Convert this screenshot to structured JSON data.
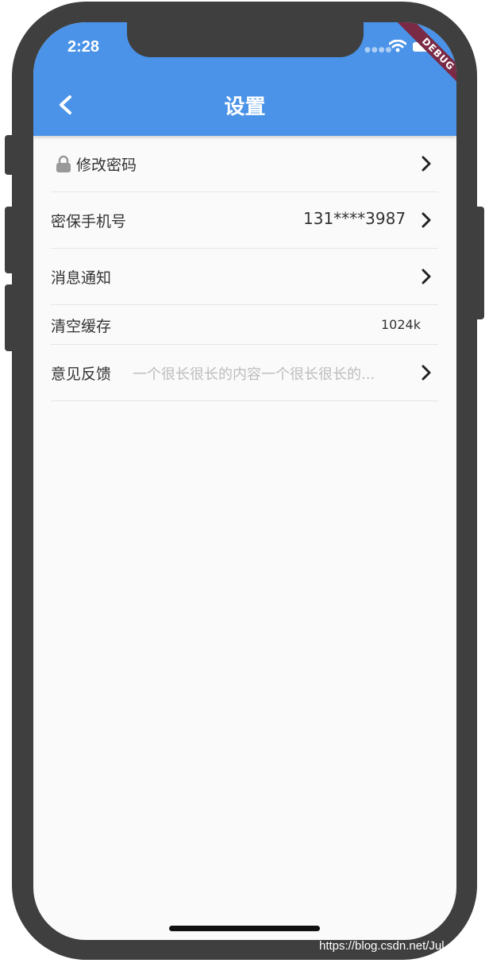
{
  "status_bar": {
    "time": "2:28",
    "debug_label": "DEBUG"
  },
  "app_bar": {
    "title": "设置"
  },
  "settings": {
    "change_password": {
      "label": "修改密码"
    },
    "security_phone": {
      "label": "密保手机号",
      "value": "131****3987"
    },
    "notifications": {
      "label": "消息通知"
    },
    "clear_cache": {
      "label": "清空缓存",
      "value": "1024k"
    },
    "feedback": {
      "label": "意见反馈",
      "value": "一个很长很长的内容一个很长很长的..."
    }
  },
  "watermark": "https://blog.csdn.net/Jul",
  "colors": {
    "app_bar": "#4a93e8",
    "background": "#fafafa",
    "frame": "#3f3f3f",
    "debug_banner": "#7a2a44"
  },
  "icons": [
    "back-icon",
    "lock-icon",
    "chevron-right-icon",
    "wifi-icon",
    "battery-icon"
  ]
}
